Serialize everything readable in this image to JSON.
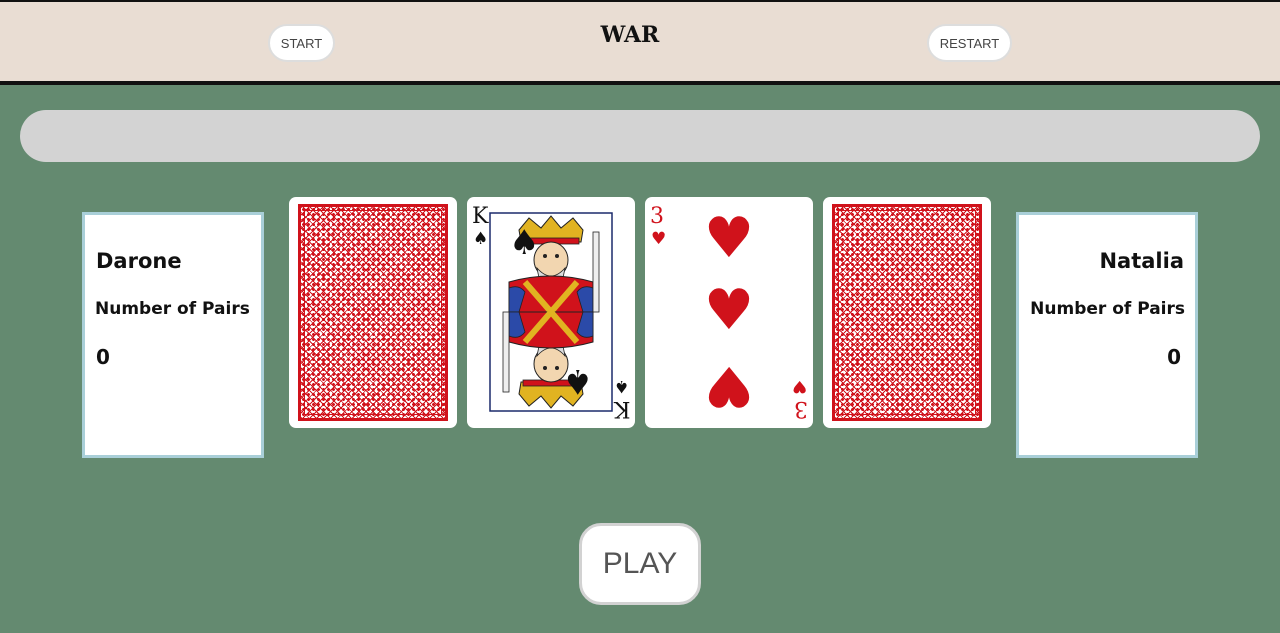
{
  "header": {
    "title": "WAR",
    "start_label": "START",
    "restart_label": "RESTART"
  },
  "message": "",
  "players": {
    "left": {
      "name": "Darone",
      "pairs_label": "Number of Pairs",
      "pairs": "0"
    },
    "right": {
      "name": "Natalia",
      "pairs_label": "Number of Pairs",
      "pairs": "0"
    }
  },
  "cards": {
    "left_deck": "face-down",
    "left_played": {
      "rank": "K",
      "suit": "♠",
      "color": "#111111"
    },
    "right_played": {
      "rank": "3",
      "suit": "♥",
      "color": "#d0121b"
    },
    "right_deck": "face-down"
  },
  "play_label": "PLAY",
  "colors": {
    "table": "#648a70",
    "header": "#e9ddd3",
    "card_back": "#d0121b",
    "panel_border": "#a9cfd8"
  }
}
